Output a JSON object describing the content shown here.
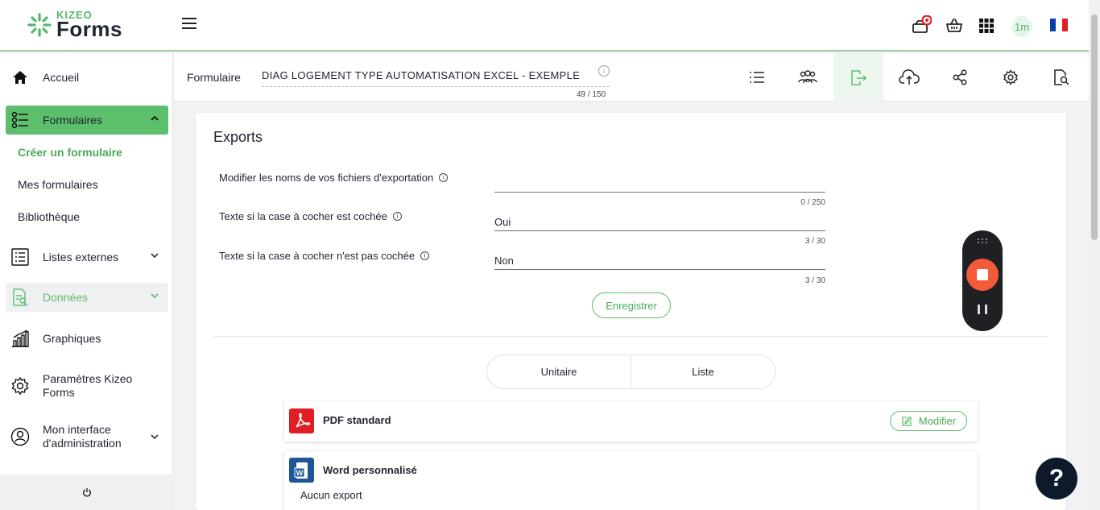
{
  "brand": {
    "small": "KIZEO",
    "big": "Forms"
  },
  "header": {
    "user_initials": "1m"
  },
  "sidebar": {
    "items": [
      {
        "label": "Accueil"
      },
      {
        "label": "Formulaires"
      },
      {
        "label": "Listes externes"
      },
      {
        "label": "Données"
      },
      {
        "label": "Graphiques"
      },
      {
        "label": "Paramètres Kizeo Forms"
      },
      {
        "label": "Mon interface d'administration"
      }
    ],
    "subitems": [
      {
        "label": "Créer un formulaire"
      },
      {
        "label": "Mes formulaires"
      },
      {
        "label": "Bibliothèque"
      }
    ]
  },
  "formbar": {
    "label": "Formulaire",
    "name": "DIAG LOGEMENT TYPE AUTOMATISATION EXCEL - EXEMPLE",
    "info": "i",
    "count": "49 / 150"
  },
  "exports": {
    "title": "Exports",
    "fields": [
      {
        "label": "Modifier les noms de vos fichiers d'exportation",
        "value": "",
        "count": "0 / 250"
      },
      {
        "label": "Texte si la case à cocher est cochée",
        "value": "Oui",
        "count": "3 / 30"
      },
      {
        "label": "Texte si la case à cocher n'est pas cochée",
        "value": "Non",
        "count": "3 / 30"
      }
    ],
    "info_glyph": "i",
    "save_label": "Enregistrer",
    "tabs": [
      {
        "label": "Unitaire"
      },
      {
        "label": "Liste"
      }
    ],
    "items": [
      {
        "name": "PDF standard",
        "action": "Modifier"
      },
      {
        "name": "Word personnalisé",
        "empty": "Aucun export"
      }
    ]
  },
  "help": {
    "label": "?"
  },
  "colors": {
    "accent": "#5cbf6c",
    "pdf": "#e01e25",
    "word": "#1f5796",
    "record": "#f25a3a"
  },
  "icons": [
    "home-icon",
    "forms-icon",
    "list-icon",
    "data-icon",
    "chart-icon",
    "gear-icon",
    "user-icon",
    "power-icon",
    "share-icon",
    "cloud-upload-icon",
    "export-icon",
    "users-icon",
    "search-doc-icon",
    "basket-icon",
    "apps-icon",
    "notification-icon"
  ]
}
